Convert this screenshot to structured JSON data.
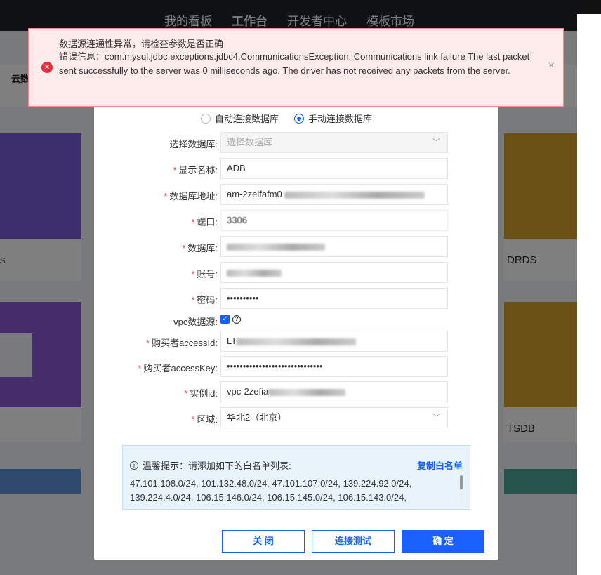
{
  "nav": {
    "items": [
      "我的看板",
      "工作台",
      "开发者中心",
      "模板市场"
    ],
    "active": "工作台"
  },
  "subtab": "云数",
  "cards": {
    "left1_name": "s",
    "right1_name": "DRDS",
    "right2_name": "TSDB"
  },
  "alert": {
    "title": "数据源连通性异常，请检查参数是否正确",
    "message": "错误信息：com.mysql.jdbc.exceptions.jdbc4.CommunicationsException: Communications link failure The last packet sent successfully to the server was 0 milliseconds ago. The driver has not received any packets from the server.",
    "close": "×",
    "colors": {
      "border": "#f28c8c",
      "background": "#fdeaea",
      "icon": "#e5303a"
    }
  },
  "dialog": {
    "connect_mode": {
      "auto_label": "自动连接数据库",
      "manual_label": "手动连接数据库",
      "selected": "manual"
    },
    "fields": {
      "select_db": {
        "label": "选择数据库:",
        "placeholder": "选择数据库"
      },
      "display_name": {
        "label": "显示名称:",
        "value": "ADB"
      },
      "db_address": {
        "label": "数据库地址:",
        "value": "am-2zelfafm0"
      },
      "port": {
        "label": "端口:",
        "value": "3306"
      },
      "database": {
        "label": "数据库:",
        "value": ""
      },
      "account": {
        "label": "账号:",
        "value": ""
      },
      "password": {
        "label": "密码:",
        "value": "••••••••••"
      },
      "vpc": {
        "label": "vpc数据源:",
        "checked": true
      },
      "access_id": {
        "label": "购买者accessId:",
        "value": "LT"
      },
      "access_key": {
        "label": "购买者accessKey:",
        "value": "••••••••••••••••••••••••••••••"
      },
      "instance_id": {
        "label": "实例id:",
        "value": "vpc-2zefia"
      },
      "region": {
        "label": "区域:",
        "value": "华北2（北京）"
      }
    },
    "tip": {
      "label": "温馨提示：请添加如下的白名单列表:",
      "copy": "复制白名单",
      "ips": "47.101.108.0/24, 101.132.48.0/24, 47.101.107.0/24, 139.224.92.0/24, 139.224.4.0/24, 106.15.146.0/24, 106.15.145.0/24, 106.15.143.0/24,"
    },
    "buttons": {
      "close": "关 闭",
      "test": "连接测试",
      "ok": "确 定"
    },
    "accent": "#1a5fff"
  }
}
